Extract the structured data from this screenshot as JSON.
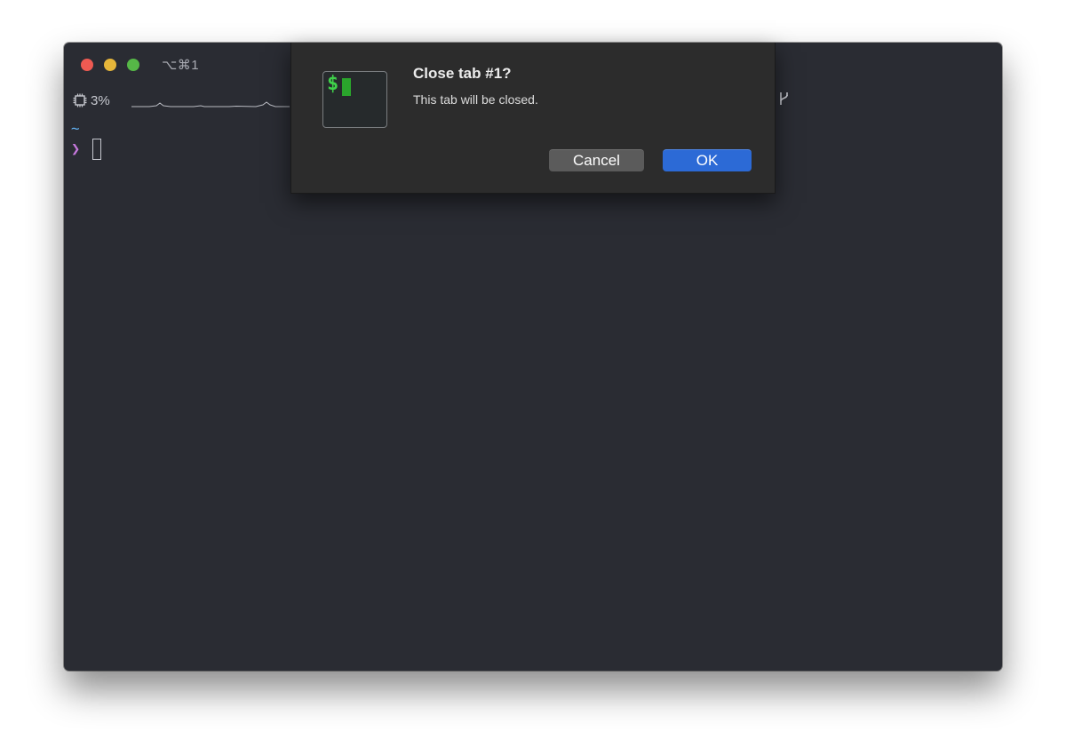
{
  "window": {
    "title_shortcut": "⌥⌘1"
  },
  "status_bar": {
    "cpu_label": "3%",
    "cpu_icon": "cpu-icon",
    "branch_icon": "git-branch-icon"
  },
  "terminal": {
    "cwd": "~",
    "prompt_symbol": "❯"
  },
  "dialog": {
    "icon": "terminal-app-icon",
    "icon_text": "$",
    "title": "Close tab #1?",
    "message": "This tab will be closed.",
    "cancel_label": "Cancel",
    "ok_label": "OK"
  },
  "colors": {
    "terminal_bg": "#2a2c33",
    "dialog_bg": "#2c2c2c",
    "ok_button": "#2c6ad6",
    "cancel_button": "#5b5b5b",
    "prompt": "#c678dd",
    "cwd": "#61afef",
    "icon_green": "#3fd14a"
  }
}
